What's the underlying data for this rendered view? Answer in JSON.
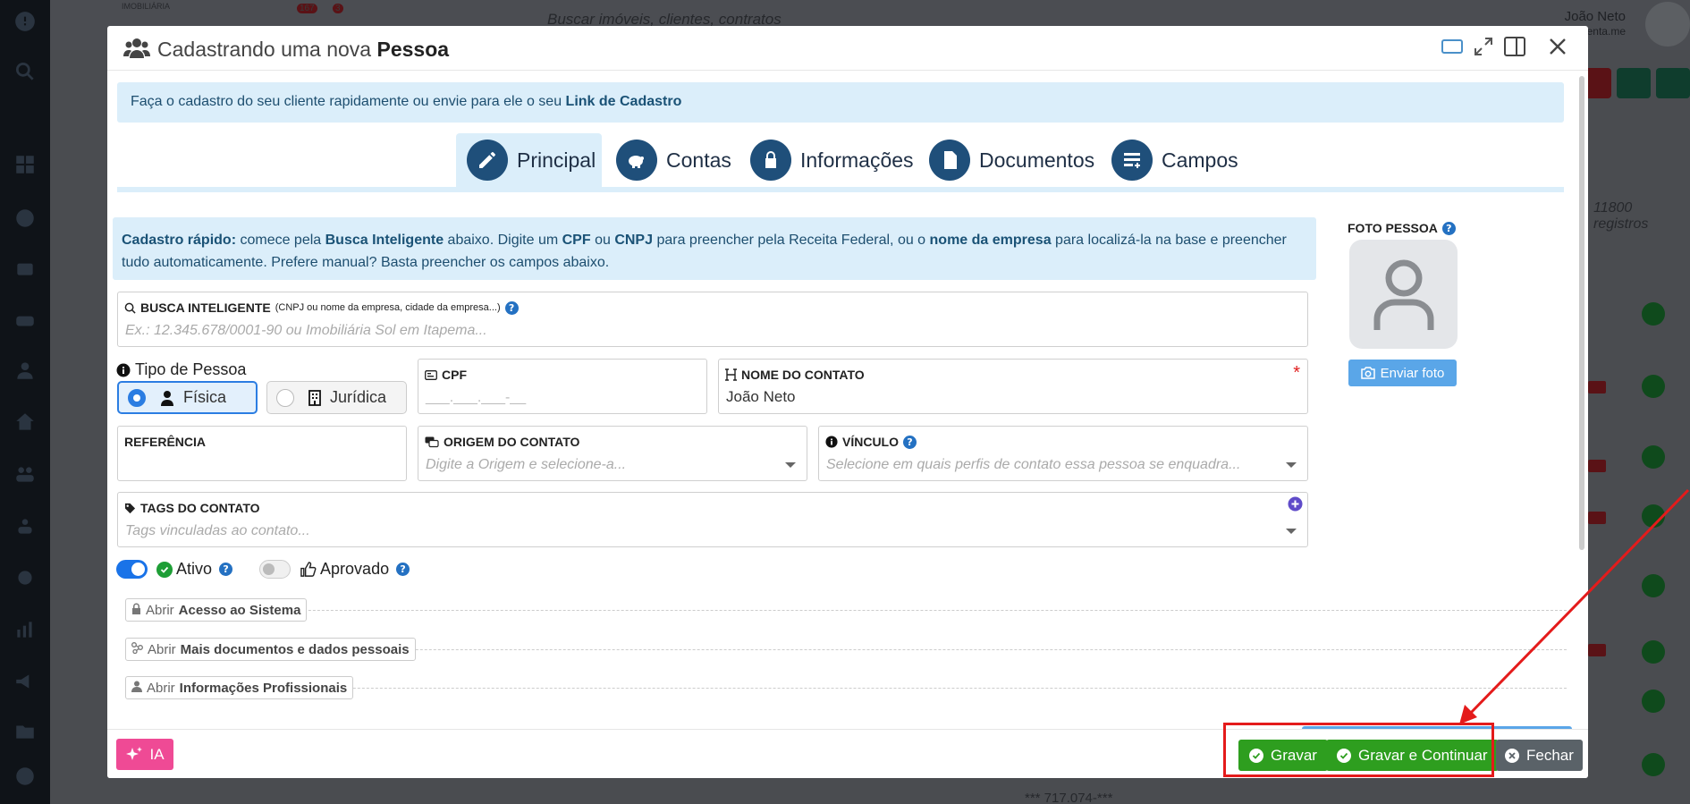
{
  "background": {
    "search_placeholder": "Buscar imóveis, clientes, contratos",
    "user_name": "João Neto",
    "user_domain": "apresenta.me",
    "records_count": "11800 registros",
    "bottom_value": "*** 717.074-***",
    "notif_badge_1": "167",
    "notif_badge_2": "3",
    "logo_small": "IMOBILIÁRIA"
  },
  "modal": {
    "title_prefix": "Cadastrando uma nova",
    "title_bold": "Pessoa",
    "info_text": "Faça o cadastro do seu cliente rapidamente ou envie para ele o seu",
    "info_link": "Link de Cadastro",
    "tabs": [
      {
        "label": "Principal",
        "icon": "pencil-icon"
      },
      {
        "label": "Contas",
        "icon": "piggy-bank-icon"
      },
      {
        "label": "Informações",
        "icon": "lock-icon"
      },
      {
        "label": "Documentos",
        "icon": "document-icon"
      },
      {
        "label": "Campos",
        "icon": "list-add-icon"
      }
    ],
    "quick": {
      "b1": "Cadastro rápido:",
      "t1": " comece pela ",
      "b2": "Busca Inteligente",
      "t2": " abaixo. Digite um ",
      "b3": "CPF",
      "t3": " ou ",
      "b4": "CNPJ",
      "t4": " para preencher pela Receita Federal, ou o ",
      "b5": "nome da empresa",
      "t5": " para localizá-la na base e preencher tudo automaticamente. Prefere manual? Basta preencher os campos abaixo."
    },
    "smart_search": {
      "label": "BUSCA INTELIGENTE",
      "hint": "(CNPJ ou nome da empresa, cidade da empresa...)",
      "placeholder": "Ex.: 12.345.678/0001-90 ou Imobiliária Sol em Itapema..."
    },
    "person_type": {
      "label": "Tipo de Pessoa",
      "options": [
        "Física",
        "Jurídica"
      ],
      "selected": "Física"
    },
    "cpf": {
      "label": "CPF",
      "mask": "___.___.___-__"
    },
    "contact_name": {
      "label": "NOME DO CONTATO",
      "value": "João Neto",
      "required_mark": "*"
    },
    "reference": {
      "label": "REFERÊNCIA",
      "value": ""
    },
    "origin": {
      "label": "ORIGEM DO CONTATO",
      "placeholder": "Digite a Origem e selecione-a..."
    },
    "link": {
      "label": "VÍNCULO",
      "placeholder": "Selecione em quais perfis de contato essa pessoa se enquadra..."
    },
    "tags": {
      "label": "TAGS DO CONTATO",
      "placeholder": "Tags vinculadas ao contato..."
    },
    "toggles": {
      "active_label": "Ativo",
      "active_on": true,
      "approved_label": "Aprovado",
      "approved_on": false
    },
    "sections": [
      {
        "prefix": "Abrir",
        "name": "Acesso ao Sistema",
        "icon": "lock-icon"
      },
      {
        "prefix": "Abrir",
        "name": "Mais documentos e dados pessoais",
        "icon": "nodes-icon"
      },
      {
        "prefix": "Abrir",
        "name": "Informações Profissionais",
        "icon": "user-tie-icon"
      }
    ],
    "photo": {
      "label": "FOTO PESSOA",
      "button": "Enviar foto"
    },
    "footer": {
      "ia": "IA",
      "save": "Gravar",
      "save_continue": "Gravar e Continuar",
      "close": "Fechar"
    },
    "help_glyph": "?"
  },
  "colors": {
    "primary": "#1f4f7a",
    "info_bg": "#dbeefa",
    "save_green": "#2e9e1f",
    "close_gray": "#5a6268",
    "ia_pink": "#ef4a95",
    "highlight_red": "#e41b1b"
  }
}
